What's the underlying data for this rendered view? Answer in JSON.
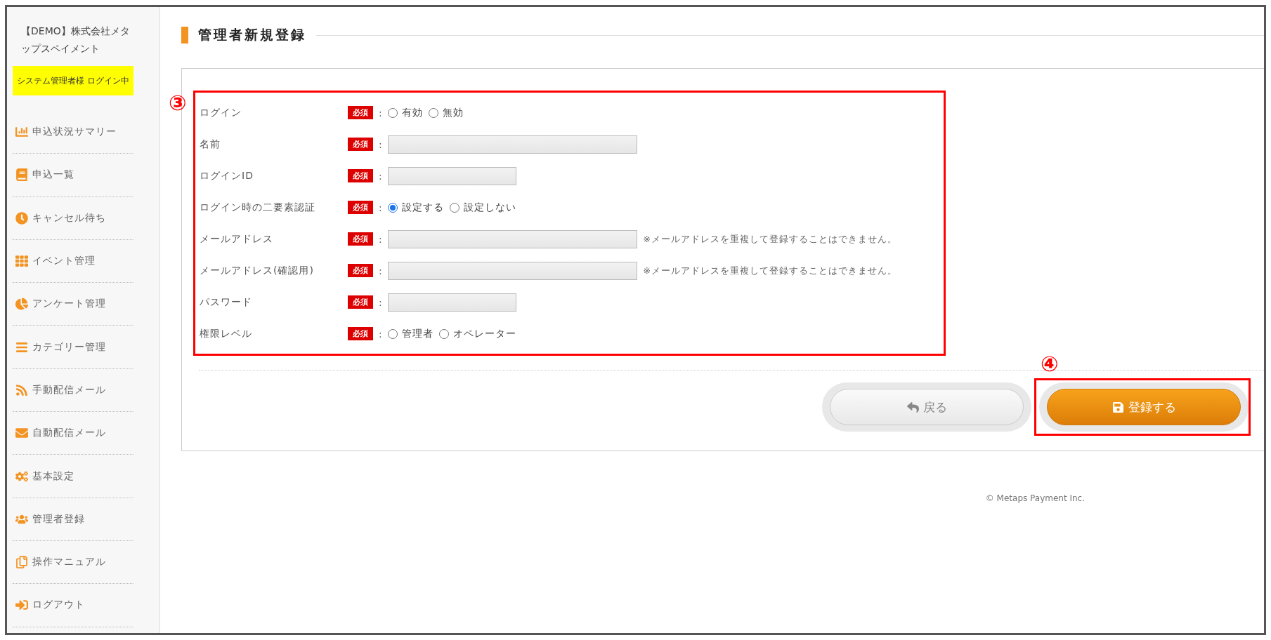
{
  "sidebar": {
    "company": "【DEMO】株式会社メタップスペイメント",
    "login_badge": "システム管理者様 ログイン中",
    "items": [
      {
        "label": "申込状況サマリー"
      },
      {
        "label": "申込一覧"
      },
      {
        "label": "キャンセル待ち"
      },
      {
        "label": "イベント管理"
      },
      {
        "label": "アンケート管理"
      },
      {
        "label": "カテゴリー管理"
      },
      {
        "label": "手動配信メール"
      },
      {
        "label": "自動配信メール"
      },
      {
        "label": "基本設定"
      },
      {
        "label": "管理者登録"
      },
      {
        "label": "操作マニュアル"
      },
      {
        "label": "ログアウト"
      }
    ]
  },
  "page_title": "管理者新規登録",
  "form": {
    "callout": "③",
    "rows": [
      {
        "label": "ログイン",
        "required": "必須",
        "separator": ":",
        "kind": "radio",
        "options": [
          {
            "label": "有効",
            "selected": false
          },
          {
            "label": "無効",
            "selected": false
          }
        ]
      },
      {
        "label": "名前",
        "required": "必須",
        "separator": ":",
        "kind": "longfield"
      },
      {
        "label": "ログインID",
        "required": "必須",
        "separator": ":",
        "kind": "shortfield"
      },
      {
        "label": "ログイン時の二要素認証",
        "required": "必須",
        "separator": ":",
        "kind": "radio",
        "options": [
          {
            "label": "設定する",
            "selected": true
          },
          {
            "label": "設定しない",
            "selected": false
          }
        ]
      },
      {
        "label": "メールアドレス",
        "required": "必須",
        "separator": ":",
        "kind": "longfield",
        "note": "※メールアドレスを重複して登録することはできません。"
      },
      {
        "label": "メールアドレス(確認用)",
        "required": "必須",
        "separator": ":",
        "kind": "longfield",
        "note": "※メールアドレスを重複して登録することはできません。"
      },
      {
        "label": "パスワード",
        "required": "必須",
        "separator": ":",
        "kind": "shortfield"
      },
      {
        "label": "権限レベル",
        "required": "必須",
        "separator": ":",
        "kind": "radio",
        "options": [
          {
            "label": "管理者",
            "selected": false
          },
          {
            "label": "オペレーター",
            "selected": false
          }
        ]
      }
    ]
  },
  "buttons": {
    "back": "戻る",
    "submit": "登録する",
    "callout": "④"
  },
  "footer": "© Metaps Payment Inc."
}
